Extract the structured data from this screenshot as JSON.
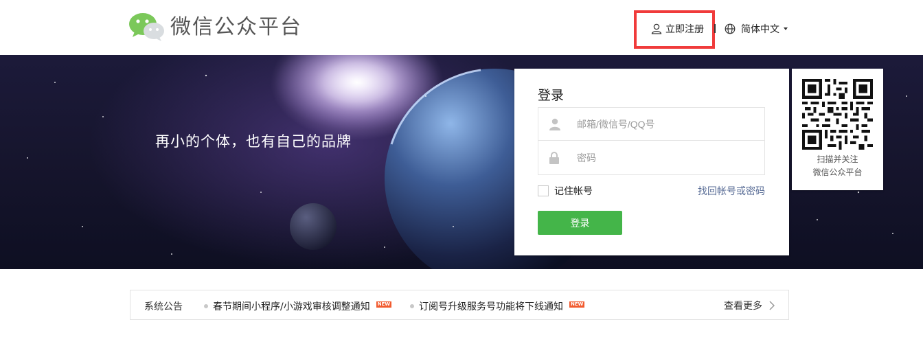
{
  "header": {
    "brand": "微信公众平台",
    "register_label": "立即注册",
    "language_label": "简体中文"
  },
  "banner": {
    "slogan": "再小的个体，也有自己的品牌"
  },
  "login": {
    "title": "登录",
    "account_placeholder": "邮箱/微信号/QQ号",
    "password_placeholder": "密码",
    "remember_label": "记住帐号",
    "forgot_label": "找回帐号或密码",
    "submit_label": "登录"
  },
  "qr": {
    "line1": "扫描并关注",
    "line2": "微信公众平台"
  },
  "notice": {
    "label": "系统公告",
    "items": [
      {
        "text": "春节期间小程序/小游戏审核调整通知",
        "badge": "NEW"
      },
      {
        "text": "订阅号升级服务号功能将下线通知",
        "badge": "NEW"
      }
    ],
    "more_label": "查看更多"
  },
  "colors": {
    "brand_green": "#44b549",
    "link_blue": "#576b95",
    "highlight_red": "#f03b3b",
    "badge_orange": "#f15b2f"
  }
}
